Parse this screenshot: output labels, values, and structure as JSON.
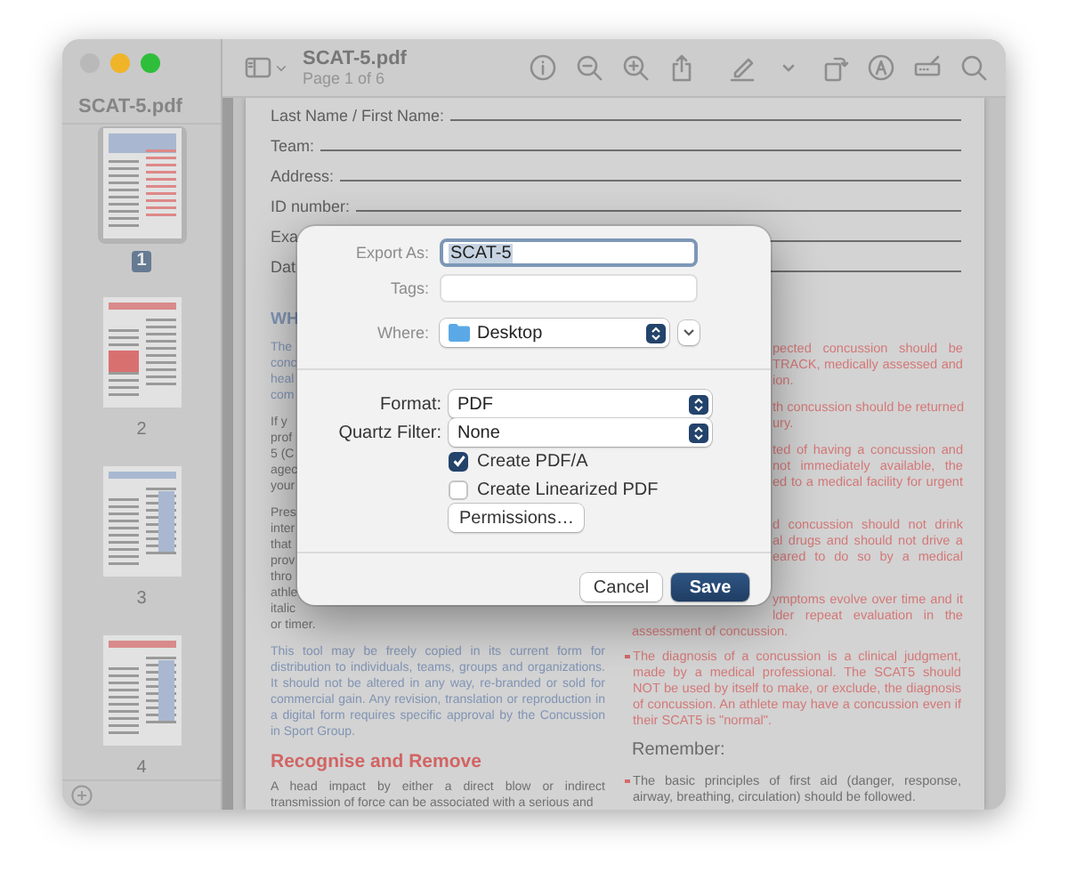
{
  "window": {
    "title": "SCAT-5.pdf",
    "subtitle": "Page 1 of 6"
  },
  "sidebar": {
    "title": "SCAT-5.pdf",
    "pages": [
      {
        "label": "1",
        "selected": true
      },
      {
        "label": "2",
        "selected": false
      },
      {
        "label": "3",
        "selected": false
      },
      {
        "label": "4",
        "selected": false
      }
    ]
  },
  "document": {
    "form_fields": [
      "Last Name / First Name:",
      "Team:",
      "Address:",
      "ID number:",
      "Exa",
      "Dat"
    ],
    "left_column": [
      {
        "kind": "title",
        "text": "WH"
      },
      {
        "kind": "note",
        "lines": [
          "The",
          "conc",
          "heal",
          "com"
        ]
      },
      {
        "kind": "text",
        "lines": [
          "If y",
          "prof",
          "5 (C",
          "agec",
          "your"
        ]
      },
      {
        "kind": "text",
        "lines": [
          "Pres",
          "inter",
          "that",
          "prov",
          "thro",
          "athle",
          "italic"
        ]
      },
      {
        "kind": "text",
        "text": "or timer."
      },
      {
        "kind": "note",
        "text": "This tool may be freely copied in its current form for distribution to individuals, teams, groups and organizations. It should not be altered in any way, re-branded or sold for commercial gain. Any revision, translation or reproduction in a digital form requires specific approval by the Concussion in Sport Group."
      },
      {
        "kind": "heading",
        "text": "Recognise and Remove"
      },
      {
        "kind": "text",
        "text": "A head impact by either a direct blow or indirect transmission of force can be associated with a serious and"
      }
    ],
    "right_column": [
      {
        "kind": "alert",
        "lines": [
          "pected concussion should be",
          "TRACK, medically assessed and",
          "ion."
        ]
      },
      {
        "kind": "alert",
        "lines": [
          "th concussion should be returned",
          "ury."
        ]
      },
      {
        "kind": "alert",
        "lines": [
          "ted of having a concussion and",
          "not immediately available, the",
          "ed to a medical facility for urgent"
        ]
      },
      {
        "kind": "alert",
        "lines": [
          "d concussion should not drink",
          "al drugs and should not drive a",
          "eared to do so by a medical"
        ]
      },
      {
        "kind": "alert",
        "lines": [
          "ymptoms evolve over time and it",
          "lder repeat evaluation in the"
        ]
      },
      {
        "kind": "alert",
        "text": "assessment of concussion."
      },
      {
        "kind": "alert_bullet",
        "text": "The diagnosis of a concussion is a clinical judgment, made by a medical professional. The SCAT5 should NOT be used by itself to make, or exclude, the diagnosis of concussion. An athlete may have a concussion even if their SCAT5 is \"normal\"."
      },
      {
        "kind": "label",
        "text": "Remember:"
      },
      {
        "kind": "bullet",
        "text": "The basic principles of first aid (danger, response, airway, breathing, circulation) should be followed."
      }
    ]
  },
  "export_dialog": {
    "export_as": {
      "label": "Export As:",
      "value": "SCAT-5"
    },
    "tags": {
      "label": "Tags:"
    },
    "where": {
      "label": "Where:",
      "value": "Desktop"
    },
    "format": {
      "label": "Format:",
      "value": "PDF"
    },
    "quartz_filter": {
      "label": "Quartz Filter:",
      "value": "None"
    },
    "options": [
      {
        "label": "Create PDF/A",
        "checked": true
      },
      {
        "label": "Create Linearized PDF",
        "checked": false
      }
    ],
    "permissions_button": "Permissions…",
    "buttons": [
      {
        "label": "Cancel",
        "kind": "secondary"
      },
      {
        "label": "Save",
        "kind": "default"
      }
    ]
  }
}
